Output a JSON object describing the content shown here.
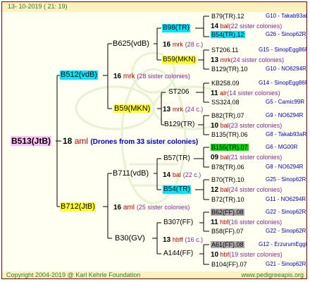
{
  "header": {
    "date": "13- 10-2019 ( 21: 19)"
  },
  "footer": {
    "copyright": "Copyright 2004-2019 @ Karl Kehrle Foundation",
    "website": "www.pedigreeapis.org"
  },
  "root": {
    "name": "B513(JtB)",
    "count": "18",
    "breeder": "aml",
    "note": "(Drones from 33 sister colonies)"
  },
  "gen1": [
    {
      "name": "B512(vdB)",
      "count": "16",
      "breeder": "mrk",
      "note": "(28 sister colonies)"
    },
    {
      "name": "B712(JtB)",
      "count": "16",
      "breeder": "aml",
      "note": "(25 sister colonies)"
    }
  ],
  "gen2": [
    {
      "name": "B625(vdB)"
    },
    {
      "name": "B59(MKN)"
    },
    {
      "name": "B711(vdB)"
    },
    {
      "name": "B30(GV)"
    }
  ],
  "gen3": [
    {
      "name": "B98(TR)",
      "count": "16",
      "breeder": "mrk",
      "note": "(28 c.)"
    },
    {
      "name": "B59(MKN)"
    },
    {
      "name": "ST206",
      "count": "13",
      "breeder": "mrk",
      "note": "(24 c.)"
    },
    {
      "name": "B129(TR)"
    },
    {
      "name": "B57(TR)",
      "count": "14",
      "breeder": "bal",
      "note": "(22 c.)"
    },
    {
      "name": "B54(TR)"
    },
    {
      "name": "B307(FF)",
      "count": "13",
      "breeder": "hbff",
      "note": "(16 c.)"
    },
    {
      "name": "A144(FF)"
    }
  ],
  "gen4": [
    {
      "type": "queen",
      "name": "B79(TR).12",
      "hl": "",
      "ref": "G10 - Takab93aR"
    },
    {
      "type": "info",
      "count": "14",
      "breeder": "bal",
      "note": "(22 sister colonies)"
    },
    {
      "type": "queen",
      "name": "B54(TR).12",
      "hl": "cy",
      "ref": "G26 - Sinop62R"
    },
    {
      "type": "queen",
      "name": "ST206.11",
      "hl": "",
      "ref": "G15 - SinopEgg86R"
    },
    {
      "type": "info",
      "count": "13",
      "breeder": "mrk",
      "note": "(24 sister colonies)"
    },
    {
      "type": "queen",
      "name": "B129(TR).10",
      "hl": "",
      "ref": "G10 - NO6294R"
    },
    {
      "type": "queen",
      "name": "KB258.09",
      "hl": "",
      "ref": "G14 - SinopEgg86R"
    },
    {
      "type": "info",
      "count": "11",
      "breeder": "alr",
      "note": "(14 sister colonies)"
    },
    {
      "type": "queen",
      "name": "SS324.08",
      "hl": "",
      "ref": "G5 - Camic99R"
    },
    {
      "type": "queen",
      "name": "B82(TR).07",
      "hl": "",
      "ref": "G9 - NO6294R"
    },
    {
      "type": "info",
      "count": "10",
      "breeder": "bal",
      "note": "(23 sister colonies)"
    },
    {
      "type": "queen",
      "name": "B135(TR).06",
      "hl": "",
      "ref": "G8 - Takab93aR"
    },
    {
      "type": "queen",
      "name": "B155(TR).07",
      "hl": "gr",
      "ref": "G6 - MG00R"
    },
    {
      "type": "info",
      "count": "09",
      "breeder": "bal",
      "note": "(21 sister colonies)"
    },
    {
      "type": "queen",
      "name": "B78(TR).06",
      "hl": "",
      "ref": "G8 - NO6294R"
    },
    {
      "type": "queen",
      "name": "B70(TR).10",
      "hl": "",
      "ref": "G25 - Sinop62R"
    },
    {
      "type": "info",
      "count": "12",
      "breeder": "bal",
      "note": "(24 sister colonies)"
    },
    {
      "type": "queen",
      "name": "B72(TR).10",
      "hl": "",
      "ref": "G11 - NO6294R"
    },
    {
      "type": "queen",
      "name": "B62(FF).08",
      "hl": "gy",
      "ref": "G22 - Sinop62R"
    },
    {
      "type": "info",
      "count": "11",
      "breeder": "hbf",
      "note": "(16 sister colonies)"
    },
    {
      "type": "queen",
      "name": "B58(FF).07",
      "hl": "",
      "ref": "G22 - Sinop62R"
    },
    {
      "type": "queen",
      "name": "A61(FF).08",
      "hl": "gy",
      "ref": "G12 - ErzurumEgg8"
    },
    {
      "type": "info",
      "count": "10",
      "breeder": "hbf",
      "note": "(19 sister colonies)"
    },
    {
      "type": "queen",
      "name": "B104(FF).07",
      "hl": "",
      "ref": "G21 - Sinop62R"
    }
  ]
}
